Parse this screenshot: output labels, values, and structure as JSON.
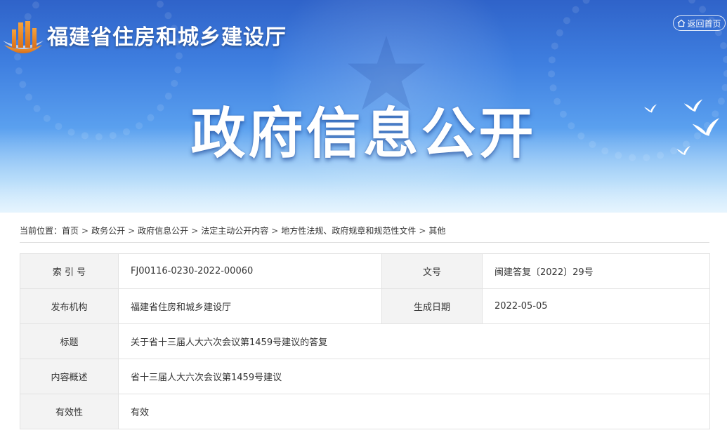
{
  "header": {
    "site_title": "福建省住房和城乡建设厅",
    "back_label": "返回首页",
    "hero_title": "政府信息公开",
    "icons": [
      "logo-icon",
      "home-icon",
      "star-emblem",
      "dove-icon"
    ]
  },
  "breadcrumb": {
    "prefix": "当前位置：",
    "separator": ">",
    "items": [
      "首页",
      "政务公开",
      "政府信息公开",
      "法定主动公开内容",
      "地方性法规、政府规章和规范性文件",
      "其他"
    ]
  },
  "info_table": {
    "index_label": "索 引 号",
    "index_value": "FJ00116-0230-2022-00060",
    "doc_no_label": "文号",
    "doc_no_value": "闽建答复〔2022〕29号",
    "publisher_label": "发布机构",
    "publisher_value": "福建省住房和城乡建设厅",
    "date_label": "生成日期",
    "date_value": "2022-05-05",
    "title_label": "标题",
    "title_value": "关于省十三届人大六次会议第1459号建议的答复",
    "summary_label": "内容概述",
    "summary_value": "省十三届人大六次会议第1459号建议",
    "validity_label": "有效性",
    "validity_value": "有效"
  },
  "colors": {
    "banner_top": "#2f63c9",
    "banner_bottom": "#dff1fd",
    "label_bg": "#f3f3f3",
    "border": "#e2e2e2",
    "logo_orange": "#e8821e"
  }
}
